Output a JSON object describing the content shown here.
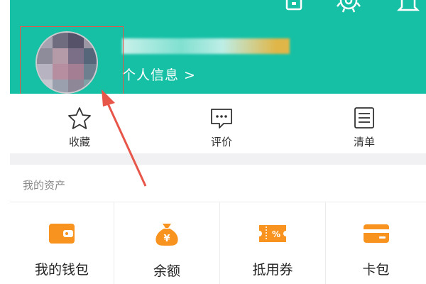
{
  "header": {
    "profile_link": "个人信息 >",
    "top_icons": [
      "qr-code-icon",
      "settings-gear-icon",
      "bell-icon"
    ]
  },
  "quick_actions": [
    {
      "label": "收藏",
      "icon": "star-icon"
    },
    {
      "label": "评价",
      "icon": "comment-icon"
    },
    {
      "label": "清单",
      "icon": "list-icon"
    }
  ],
  "assets": {
    "title": "我的资产",
    "items": [
      {
        "label": "我的钱包",
        "icon": "wallet-icon"
      },
      {
        "label": "余额",
        "icon": "money-bag-icon"
      },
      {
        "label": "抵用券",
        "icon": "coupon-icon"
      },
      {
        "label": "卡包",
        "icon": "card-icon"
      }
    ]
  },
  "colors": {
    "header_bg": "#16c0a5",
    "asset_icon": "#f7931e",
    "annotation_red": "#e8564a"
  }
}
